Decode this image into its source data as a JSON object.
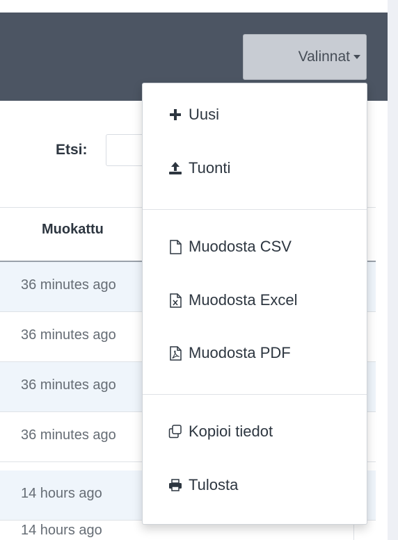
{
  "header": {
    "options_button": "Valinnat"
  },
  "search": {
    "label": "Etsi:"
  },
  "table": {
    "column": "Muokattu",
    "rows": [
      "36 minutes ago",
      "36 minutes ago",
      "36 minutes ago",
      "36 minutes ago",
      "14 hours ago",
      "14 hours ago"
    ]
  },
  "menu": {
    "items": [
      {
        "label": "Uusi",
        "icon": "plus-icon"
      },
      {
        "label": "Tuonti",
        "icon": "upload-icon"
      },
      {
        "label": "Muodosta CSV",
        "icon": "file-icon"
      },
      {
        "label": "Muodosta Excel",
        "icon": "file-excel-icon"
      },
      {
        "label": "Muodosta PDF",
        "icon": "file-pdf-icon"
      },
      {
        "label": "Kopioi tiedot",
        "icon": "copy-icon"
      },
      {
        "label": "Tulosta",
        "icon": "print-icon"
      }
    ]
  }
}
